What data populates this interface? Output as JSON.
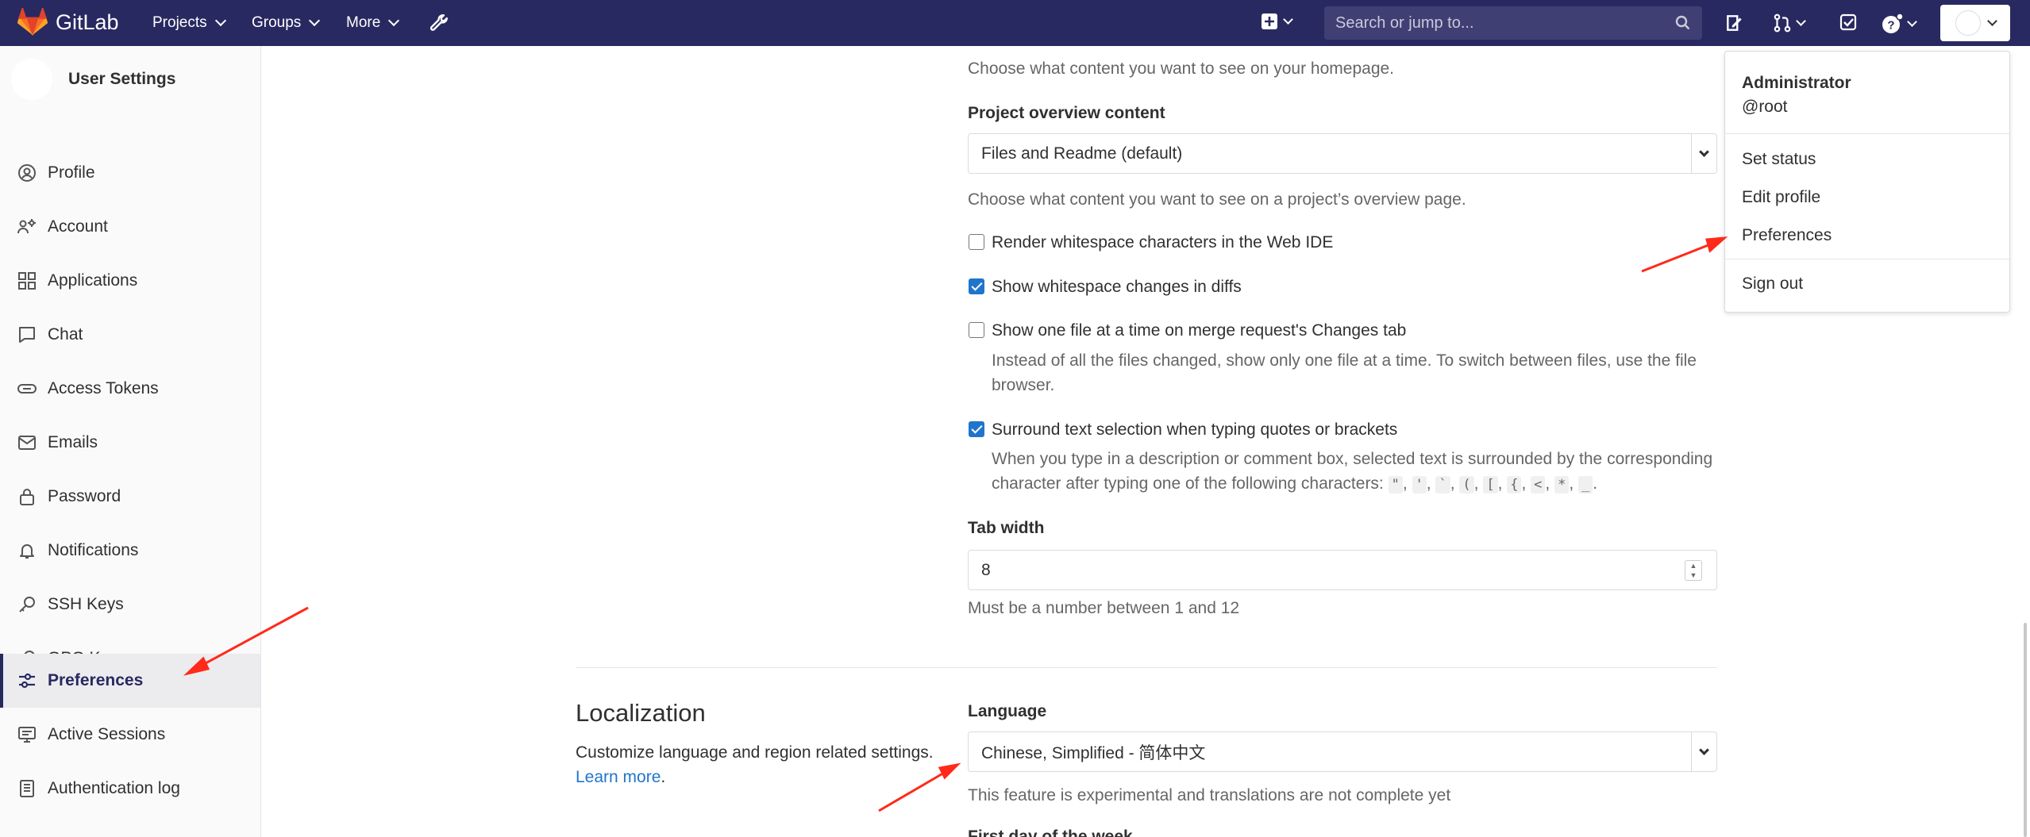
{
  "navbar": {
    "brand": "GitLab",
    "projects": "Projects",
    "groups": "Groups",
    "more": "More",
    "search_placeholder": "Search or jump to...",
    "bg_color": "#292961"
  },
  "sidebar": {
    "title": "User Settings",
    "items": [
      {
        "label": "Profile",
        "icon": "profile-icon"
      },
      {
        "label": "Account",
        "icon": "account-icon"
      },
      {
        "label": "Applications",
        "icon": "applications-icon"
      },
      {
        "label": "Chat",
        "icon": "chat-icon"
      },
      {
        "label": "Access Tokens",
        "icon": "token-icon"
      },
      {
        "label": "Emails",
        "icon": "mail-icon"
      },
      {
        "label": "Password",
        "icon": "lock-icon"
      },
      {
        "label": "Notifications",
        "icon": "bell-icon"
      },
      {
        "label": "SSH Keys",
        "icon": "key-icon"
      },
      {
        "label": "GPG Keys",
        "icon": "key-icon"
      },
      {
        "label": "Preferences",
        "icon": "preferences-icon",
        "active": true
      },
      {
        "label": "Active Sessions",
        "icon": "monitor-icon"
      },
      {
        "label": "Authentication log",
        "icon": "log-icon"
      }
    ]
  },
  "main": {
    "homepage_help": "Choose what content you want to see on your homepage.",
    "project_overview_label": "Project overview content",
    "project_overview_value": "Files and Readme (default)",
    "project_overview_help": "Choose what content you want to see on a project’s overview page.",
    "render_whitespace": {
      "label": "Render whitespace characters in the Web IDE",
      "checked": false
    },
    "show_whitespace": {
      "label": "Show whitespace changes in diffs",
      "checked": true
    },
    "one_file": {
      "label": "Show one file at a time on merge request's Changes tab",
      "checked": false,
      "help_line1": "Instead of all the files changed, show only one file at a time. To switch between files, use the file",
      "help_line2": "browser."
    },
    "surround": {
      "label": "Surround text selection when typing quotes or brackets",
      "checked": true,
      "help_line1": "When you type in a description or comment box, selected text is surrounded by the corresponding",
      "help_line2_prefix": "character after typing one of the following characters:",
      "chars": [
        "\"",
        "'",
        "`",
        "(",
        "[",
        "{",
        "<",
        "*",
        "_"
      ]
    },
    "tab_width_label": "Tab width",
    "tab_width_value": "8",
    "tab_width_help": "Must be a number between 1 and 12",
    "localization_title": "Localization",
    "localization_desc": "Customize language and region related settings.",
    "learn_more": "Learn more",
    "language_label": "Language",
    "language_value": "Chinese, Simplified - 简体中文",
    "language_help": "This feature is experimental and translations are not complete yet",
    "next_label_partial": "First day of the week"
  },
  "dropdown": {
    "name": "Administrator",
    "username": "@root",
    "items": [
      "Set status",
      "Edit profile",
      "Preferences",
      "Sign out"
    ]
  },
  "colors": {
    "accent": "#1f75cb",
    "annotation_arrow": "#ff2a1a"
  }
}
